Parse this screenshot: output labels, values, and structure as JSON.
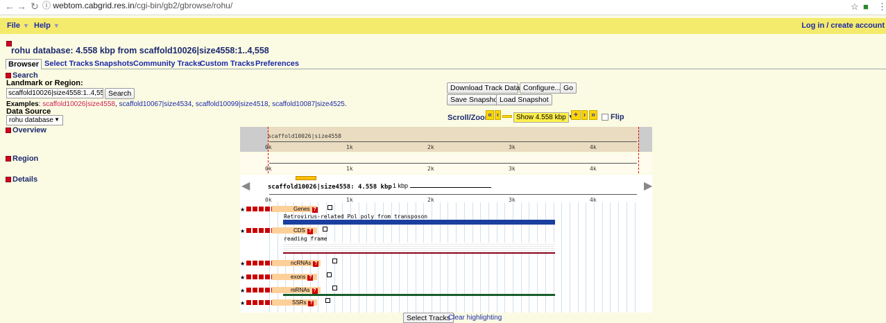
{
  "browser": {
    "url_host": "webtom.cabgrid.res.in",
    "url_path": "/cgi-bin/gb2/gbrowse/rohu/"
  },
  "menu": {
    "file": "File",
    "help": "Help",
    "login": "Log in / create account"
  },
  "page_title": "rohu database: 4.558 kbp from scaffold10026|size4558:1..4,558",
  "tabs": [
    "Browser",
    "Select Tracks",
    "Snapshots",
    "Community Tracks",
    "Custom Tracks",
    "Preferences"
  ],
  "search": {
    "heading": "Search",
    "landmark_label": "Landmark or Region:",
    "landmark_value": "scaffold10026|size4558:1..4,558",
    "search_button": "Search",
    "examples_label": "Examples",
    "examples": [
      "scaffold10026|size4558",
      "scaffold10067|size4534",
      "scaffold10099|size4518",
      "scaffold10087|size4525"
    ],
    "data_source_label": "Data Source",
    "data_source_value": "rohu database"
  },
  "tools": {
    "download_track_data": "Download Track Data",
    "configure": "Configure...",
    "go": "Go",
    "save_snapshot": "Save Snapshot",
    "load_snapshot": "Load Snapshot",
    "scroll_zoom_label": "Scroll/Zoom:",
    "show_value": "Show 4.558 kbp",
    "flip_label": "Flip"
  },
  "sections": {
    "overview": "Overview",
    "region": "Region",
    "details": "Details"
  },
  "overview_panel": {
    "landmark_label": "scaffold10026|size4558",
    "ticks": [
      "0k",
      "1k",
      "2k",
      "3k",
      "4k"
    ]
  },
  "region_panel": {
    "ticks": [
      "0k",
      "1k",
      "2k",
      "3k",
      "4k"
    ]
  },
  "details_panel": {
    "header": "scaffold10026|size4558: 4.558 kbp",
    "scale_label": "1 kbp",
    "ticks": [
      "0k",
      "1k",
      "2k",
      "3k",
      "4k"
    ],
    "tracks": [
      {
        "name": "Genes",
        "feature_label": "Retrovirus-related Pol poly from transposon",
        "color": "#1b3f9e"
      },
      {
        "name": "CDS",
        "feature_label": "reading frame",
        "color": "#8b0018"
      },
      {
        "name": "ncRNAs",
        "feature_label": "",
        "color": ""
      },
      {
        "name": "exons",
        "feature_label": "",
        "color": ""
      },
      {
        "name": "mRNAs",
        "feature_label": "",
        "color": "#155e2b"
      },
      {
        "name": "SSRs",
        "feature_label": "",
        "color": ""
      }
    ]
  },
  "bottom": {
    "select_tracks": "Select Tracks",
    "clear_highlighting": "Clear highlighting"
  }
}
